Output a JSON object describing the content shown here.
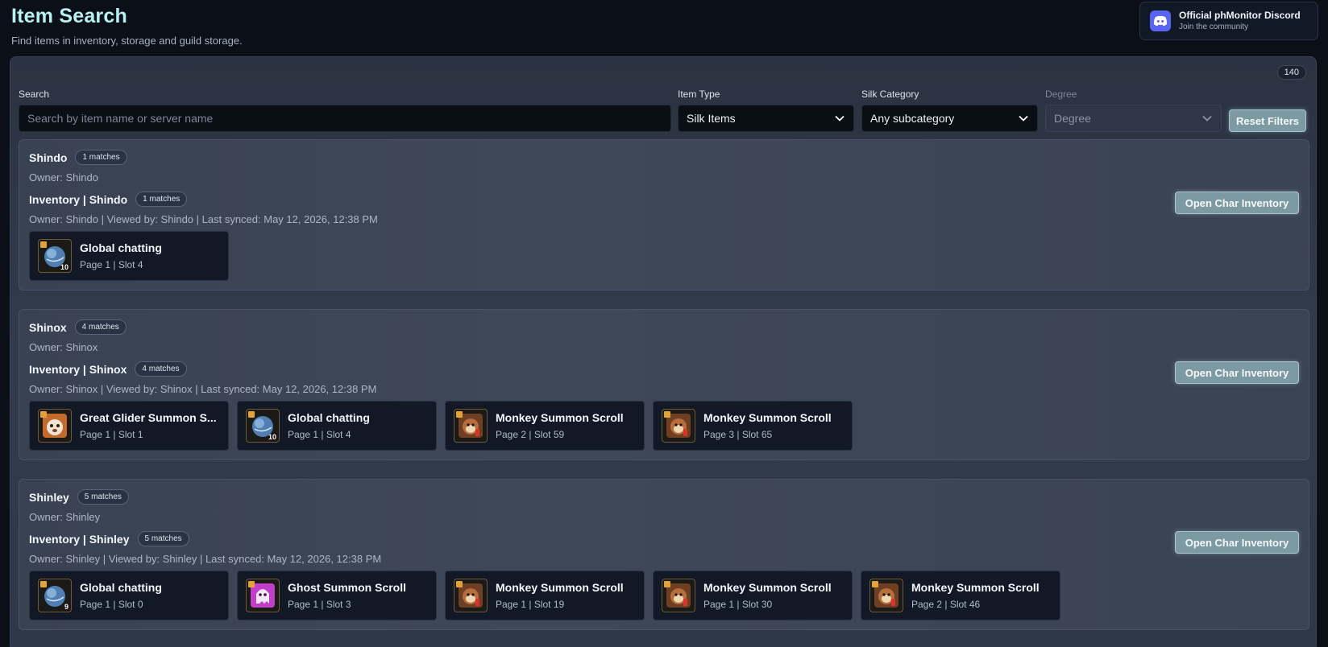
{
  "header": {
    "title": "Item Search",
    "subtitle": "Find items in inventory, storage and guild storage."
  },
  "discord": {
    "title": "Official phMonitor Discord",
    "subtitle": "Join the community",
    "icon": "discord-icon"
  },
  "results_count": "140",
  "filters": {
    "search_label": "Search",
    "search_placeholder": "Search by item name or server name",
    "search_value": "",
    "item_type_label": "Item Type",
    "item_type_value": "Silk Items",
    "silk_category_label": "Silk Category",
    "silk_category_value": "Any subcategory",
    "degree_label": "Degree",
    "degree_value": "Degree",
    "reset_label": "Reset Filters"
  },
  "characters": [
    {
      "name": "Shindo",
      "matches": "1 matches",
      "owner": "Owner: Shindo",
      "inventory_title": "Inventory | Shindo",
      "inventory_matches": "1 matches",
      "meta": "Owner: Shindo | Viewed by: Shindo | Last synced: May 12, 2026, 12:38 PM",
      "button": "Open Char Inventory",
      "items": [
        {
          "name": "Global chatting",
          "slot": "Page 1 | Slot 4",
          "icon": "globe-icon",
          "qty": "10"
        }
      ]
    },
    {
      "name": "Shinox",
      "matches": "4 matches",
      "owner": "Owner: Shinox",
      "inventory_title": "Inventory | Shinox",
      "inventory_matches": "4 matches",
      "meta": "Owner: Shinox | Viewed by: Shinox | Last synced: May 12, 2026, 12:38 PM",
      "button": "Open Char Inventory",
      "items": [
        {
          "name": "Great Glider Summon S...",
          "slot": "Page 1 | Slot 1",
          "icon": "glider-icon",
          "qty": ""
        },
        {
          "name": "Global chatting",
          "slot": "Page 1 | Slot 4",
          "icon": "globe-icon",
          "qty": "10"
        },
        {
          "name": "Monkey Summon Scroll",
          "slot": "Page 2 | Slot 59",
          "icon": "monkey-icon",
          "qty": ""
        },
        {
          "name": "Monkey Summon Scroll",
          "slot": "Page 3 | Slot 65",
          "icon": "monkey-icon",
          "qty": ""
        }
      ]
    },
    {
      "name": "Shinley",
      "matches": "5 matches",
      "owner": "Owner: Shinley",
      "inventory_title": "Inventory | Shinley",
      "inventory_matches": "5 matches",
      "meta": "Owner: Shinley | Viewed by: Shinley | Last synced: May 12, 2026, 12:38 PM",
      "button": "Open Char Inventory",
      "items": [
        {
          "name": "Global chatting",
          "slot": "Page 1 | Slot 0",
          "icon": "globe-icon",
          "qty": "9"
        },
        {
          "name": "Ghost Summon Scroll",
          "slot": "Page 1 | Slot 3",
          "icon": "ghost-icon",
          "qty": ""
        },
        {
          "name": "Monkey Summon Scroll",
          "slot": "Page 1 | Slot 19",
          "icon": "monkey-icon",
          "qty": ""
        },
        {
          "name": "Monkey Summon Scroll",
          "slot": "Page 1 | Slot 30",
          "icon": "monkey-icon",
          "qty": ""
        },
        {
          "name": "Monkey Summon Scroll",
          "slot": "Page 2 | Slot 46",
          "icon": "monkey-icon",
          "qty": ""
        }
      ]
    }
  ]
}
